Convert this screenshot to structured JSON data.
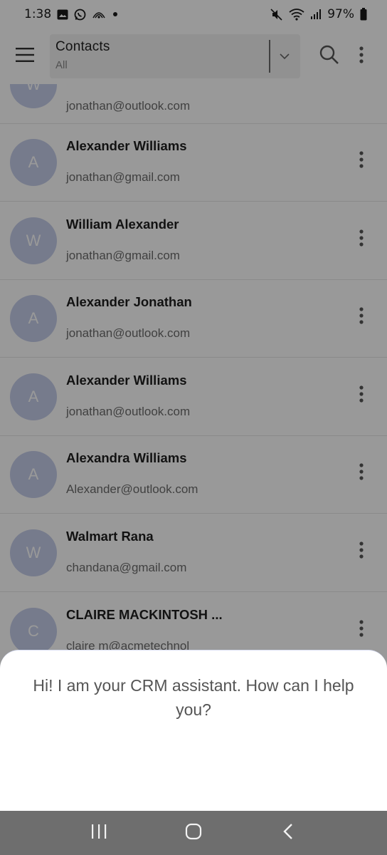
{
  "status_bar": {
    "time": "1:38",
    "battery": "97%",
    "icons_left": [
      "gallery-icon",
      "whatsapp-icon",
      "cast-icon",
      "dot-icon"
    ],
    "icons_right": [
      "mute-icon",
      "wifi-icon",
      "signal-icon",
      "battery-icon"
    ]
  },
  "app_bar": {
    "title": "Contacts",
    "filter": "All",
    "icons": [
      "menu-icon",
      "chevron-down-icon",
      "search-icon",
      "more-vert-icon"
    ]
  },
  "contacts": [
    {
      "initial": "W",
      "name": "",
      "email": "jonathan@outlook.com"
    },
    {
      "initial": "A",
      "name": "Alexander Williams",
      "email": "jonathan@gmail.com"
    },
    {
      "initial": "W",
      "name": "William Alexander",
      "email": "jonathan@gmail.com"
    },
    {
      "initial": "A",
      "name": "Alexander Jonathan",
      "email": "jonathan@outlook.com"
    },
    {
      "initial": "A",
      "name": "Alexander Williams",
      "email": "jonathan@outlook.com"
    },
    {
      "initial": "A",
      "name": "Alexandra Williams",
      "email": "Alexander@outlook.com"
    },
    {
      "initial": "W",
      "name": "Walmart Rana",
      "email": "chandana@gmail.com"
    },
    {
      "initial": "C",
      "name": "CLAIRE MACKINTOSH ...",
      "email": "claire m@acmetechnol"
    }
  ],
  "assistant": {
    "message": "Hi! I am your CRM assistant. How can I help you?"
  },
  "nav_bar": {
    "icons": [
      "recents-icon",
      "home-icon",
      "back-icon"
    ]
  },
  "colors": {
    "avatar": "#c5cdea",
    "scrim": "rgba(0,0,0,0.40)",
    "nav_bar": "#6e6e6e"
  }
}
